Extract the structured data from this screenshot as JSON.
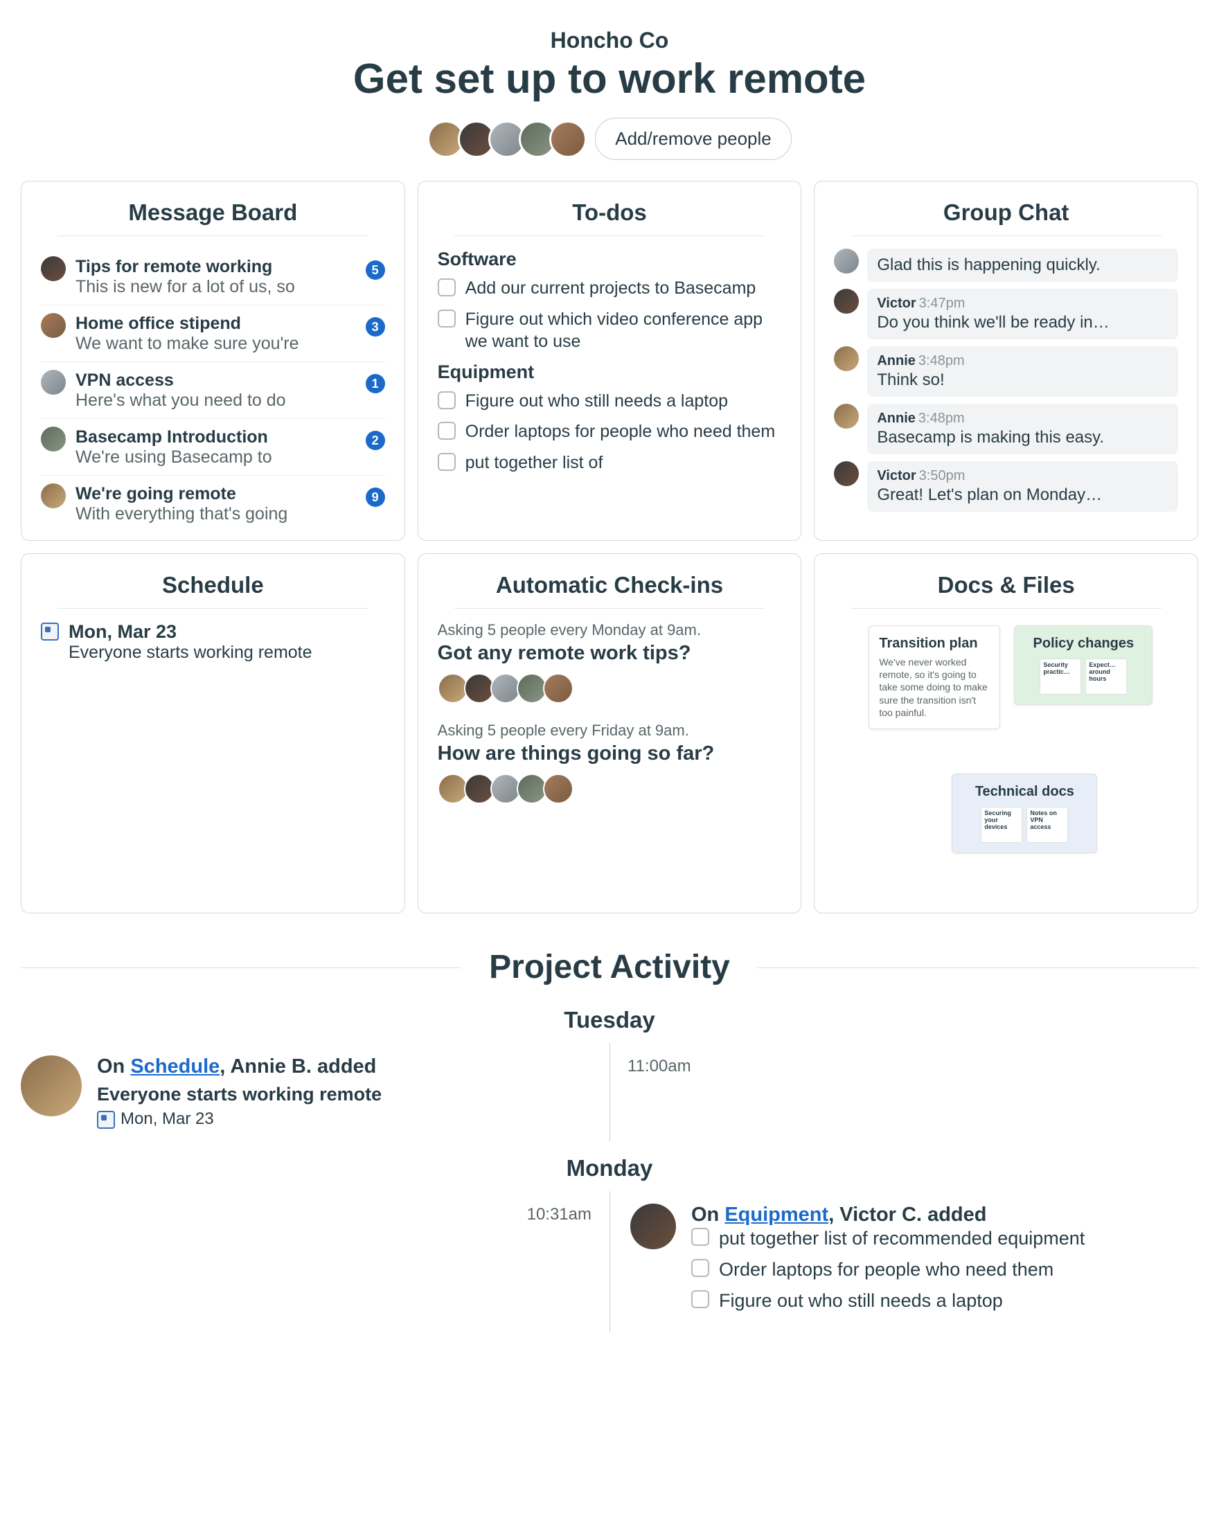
{
  "header": {
    "company": "Honcho Co",
    "title": "Get set up to work remote",
    "add_remove_label": "Add/remove people",
    "avatar_colors": [
      "c1",
      "c2",
      "c3",
      "c4",
      "c5"
    ]
  },
  "message_board": {
    "title": "Message Board",
    "items": [
      {
        "avatar": "c2",
        "title": "Tips for remote working",
        "excerpt": "This is new for a lot of us, so",
        "count": "5"
      },
      {
        "avatar": "c5",
        "title": "Home office stipend",
        "excerpt": "We want to make sure you're",
        "count": "3"
      },
      {
        "avatar": "c3",
        "title": "VPN access",
        "excerpt": "Here's what you need to do",
        "count": "1"
      },
      {
        "avatar": "c4",
        "title": "Basecamp Introduction",
        "excerpt": "We're using Basecamp to",
        "count": "2"
      },
      {
        "avatar": "c1",
        "title": "We're going remote",
        "excerpt": "With everything that's going",
        "count": "9"
      }
    ]
  },
  "todos": {
    "title": "To-dos",
    "sections": [
      {
        "name": "Software",
        "items": [
          "Add our current projects to Basecamp",
          "Figure out which video conference app we want to use"
        ]
      },
      {
        "name": "Equipment",
        "items": [
          "Figure out who still needs a laptop",
          "Order laptops for people who need them",
          "put together list of"
        ]
      }
    ]
  },
  "group_chat": {
    "title": "Group Chat",
    "messages": [
      {
        "avatar": "c3",
        "name": "",
        "time": "",
        "text": "Glad this is happening quickly.",
        "no_meta": true
      },
      {
        "avatar": "c2",
        "name": "Victor",
        "time": "3:47pm",
        "text": "Do you think we'll be ready in…"
      },
      {
        "avatar": "c1",
        "name": "Annie",
        "time": "3:48pm",
        "text": "Think so!"
      },
      {
        "avatar": "c1",
        "name": "Annie",
        "time": "3:48pm",
        "text": "Basecamp is making this easy."
      },
      {
        "avatar": "c2",
        "name": "Victor",
        "time": "3:50pm",
        "text": "Great! Let's plan on Monday…"
      }
    ]
  },
  "schedule": {
    "title": "Schedule",
    "date": "Mon, Mar 23",
    "desc": "Everyone starts working remote"
  },
  "checkins": {
    "title": "Automatic Check-ins",
    "items": [
      {
        "meta": "Asking 5 people every Monday at 9am.",
        "question": "Got any remote work tips?",
        "avatars": [
          "c1",
          "c2",
          "c3",
          "c4",
          "c5"
        ]
      },
      {
        "meta": "Asking 5 people every Friday at 9am.",
        "question": "How are things going so far?",
        "avatars": [
          "c1",
          "c2",
          "c3",
          "c4",
          "c5"
        ]
      }
    ]
  },
  "docs": {
    "title": "Docs & Files",
    "thumb1": {
      "title": "Transition plan",
      "body": "We've never worked remote, so it's going to take some doing to make sure the transition isn't too painful."
    },
    "thumb2": {
      "title": "Policy changes",
      "mini": [
        "Security practic…",
        "Expect… around hours"
      ]
    },
    "thumb3": {
      "title": "Technical docs",
      "mini": [
        "Securing your devices",
        "Notes on VPN access"
      ]
    }
  },
  "activity": {
    "title": "Project Activity",
    "days": [
      {
        "label": "Tuesday",
        "entries": [
          {
            "side": "left",
            "time": "11:00am",
            "avatar": "c1",
            "on_prefix": "On ",
            "link": "Schedule",
            "on_suffix": ", Annie B. added",
            "subtitle": "Everyone starts working remote",
            "date": "Mon, Mar 23"
          }
        ]
      },
      {
        "label": "Monday",
        "entries": [
          {
            "side": "right",
            "time": "10:31am",
            "avatar": "c2",
            "on_prefix": "On ",
            "link": "Equipment",
            "on_suffix": ", Victor C. added",
            "todos": [
              "put together list of recommended equipment",
              "Order laptops for people who need them",
              "Figure out who still needs a laptop"
            ]
          }
        ]
      }
    ]
  }
}
